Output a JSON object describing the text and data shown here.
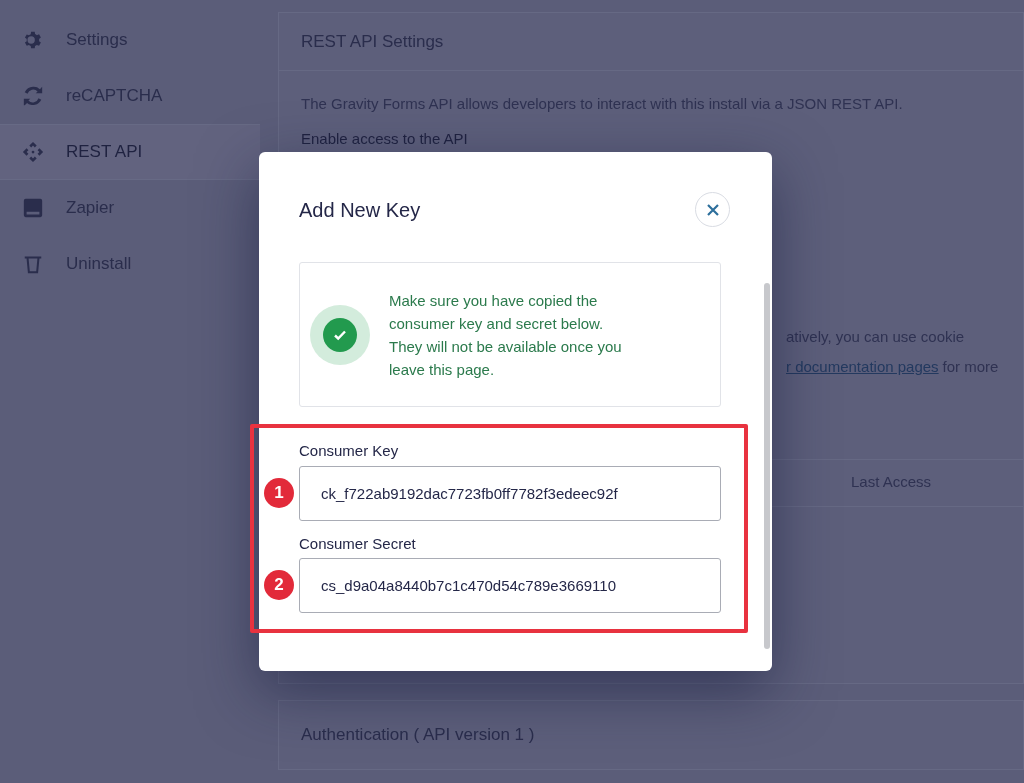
{
  "sidebar": {
    "items": [
      {
        "label": "Settings",
        "selected": false
      },
      {
        "label": "reCAPTCHA",
        "selected": false
      },
      {
        "label": "REST API",
        "selected": true
      },
      {
        "label": "Zapier",
        "selected": false
      },
      {
        "label": "Uninstall",
        "selected": false
      }
    ]
  },
  "settings_panel": {
    "title": "REST API Settings",
    "description": "The Gravity Forms API allows developers to interact with this install via a JSON REST API.",
    "enable_label": "Enable access to the API",
    "text_fragment": "atively, you can use cookie",
    "link_fragment": "r documentation pages",
    "text_after_link": "for more",
    "table": {
      "columns": [
        "Last Access"
      ]
    }
  },
  "auth_panel": {
    "title": "Authentication ( API version 1 )"
  },
  "modal": {
    "title": "Add New Key",
    "notice": "Make sure you have copied the consumer key and secret below. They will not be available once you leave this page.",
    "fields": [
      {
        "label": "Consumer Key",
        "value": "ck_f722ab9192dac7723fb0ff7782f3edeec92f",
        "badge": "1"
      },
      {
        "label": "Consumer Secret",
        "value": "cs_d9a04a8440b7c1c470d54c789e3669110",
        "badge": "2"
      }
    ]
  }
}
